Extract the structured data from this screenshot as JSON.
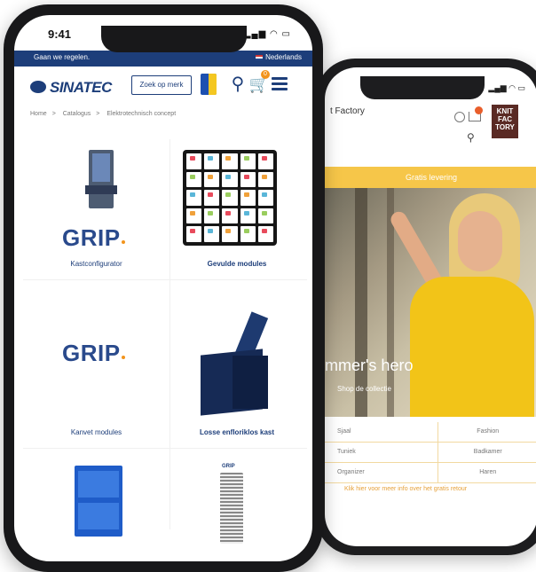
{
  "back_phone": {
    "brand": "t Factory",
    "logo_text": "KNIT FACTORY",
    "banner_text": "Gratis levering",
    "hero_text": "mmer's hero",
    "hero_sub": "Shop de collectie",
    "grid": [
      [
        "Sjaal",
        "Fashion"
      ],
      [
        "Tuniek",
        "Badkamer"
      ],
      [
        "Organizer",
        "Haren"
      ]
    ],
    "link": "Klik hier voor meer info over het gratis retour"
  },
  "front_phone": {
    "status": {
      "time": "9:41",
      "signals": "▂▄▆ ◠ ▭"
    },
    "topbar": {
      "left": "Gaan we regelen.",
      "right": "Nederlands"
    },
    "nav": {
      "logo": "SINATEC",
      "zoek_label": "Zoek op merk",
      "cart_count": "0"
    },
    "breadcrumb": [
      "Home",
      "Catalogus",
      "Elektrotechnisch concept"
    ],
    "products": [
      {
        "title": "Kastconfigurator",
        "image_text": "GRIP"
      },
      {
        "title": "Gevulde modules"
      },
      {
        "title": "Kanvet modules",
        "image_text": "GRIP"
      },
      {
        "title": "Losse enfloriklos kast"
      },
      {
        "title": ""
      },
      {
        "title": "",
        "image_text": "GRIP"
      }
    ]
  },
  "colors": {
    "navy": "#1d3e7a",
    "accent_orange": "#f2941c",
    "yellow": "#f6c649"
  }
}
